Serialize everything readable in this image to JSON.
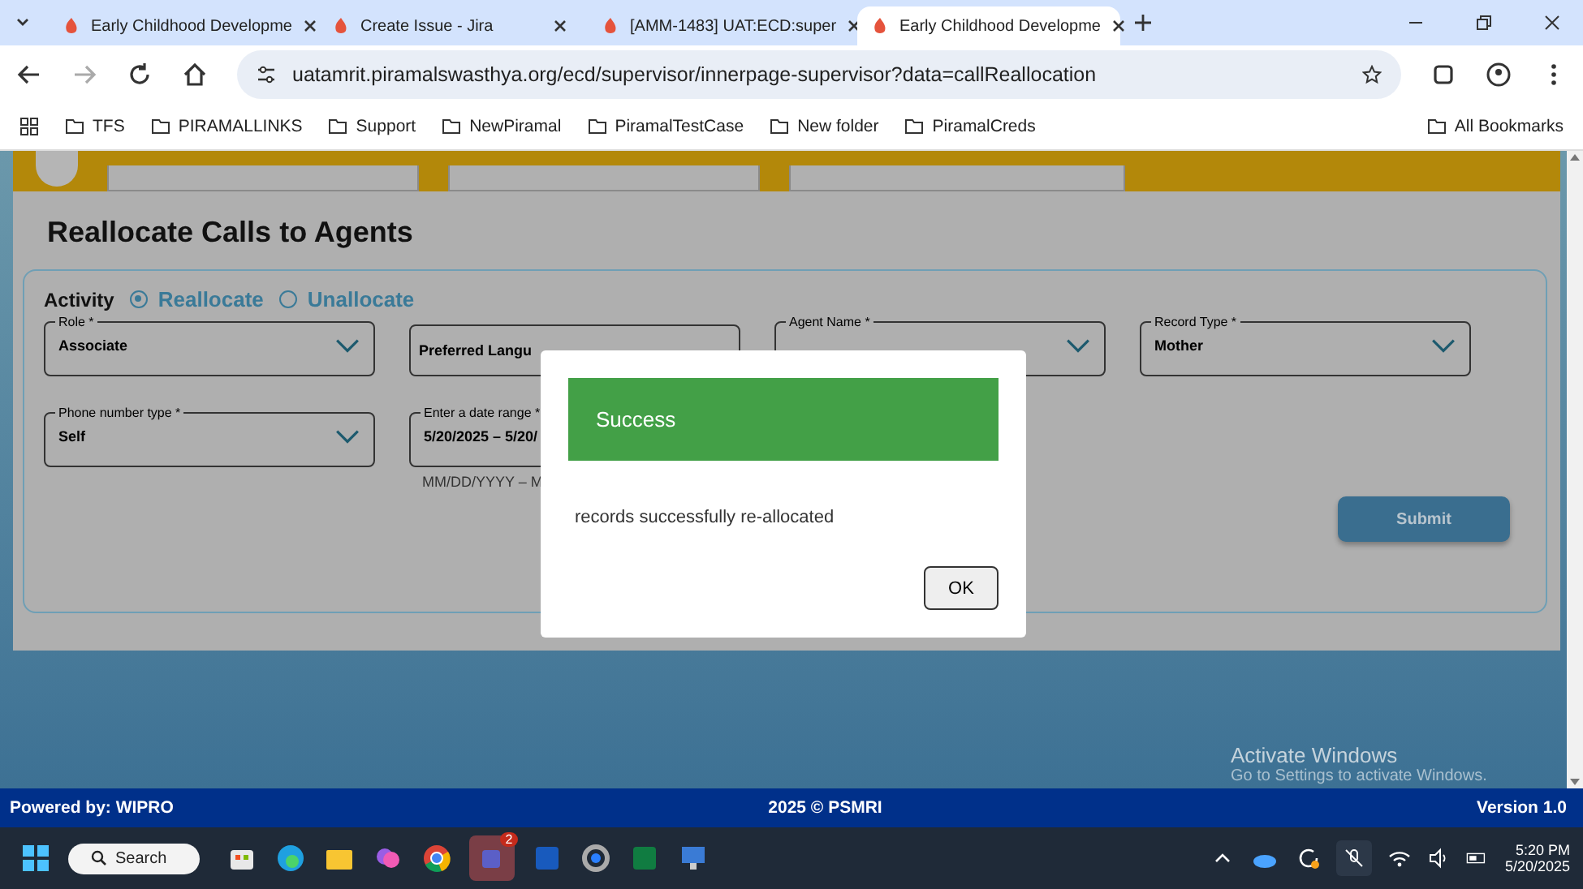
{
  "browser": {
    "tabs": [
      {
        "title": "Early Childhood Developme",
        "selected": false
      },
      {
        "title": "Create Issue - Jira",
        "selected": false
      },
      {
        "title": "[AMM-1483] UAT:ECD:super",
        "selected": false
      },
      {
        "title": "Early Childhood Developme",
        "selected": true
      }
    ],
    "address": "uatamrit.piramalswasthya.org/ecd/supervisor/innerpage-supervisor?data=callReallocation",
    "bookmarks": [
      "TFS",
      "PIRAMALLINKS",
      "Support",
      "NewPiramal",
      "PiramalTestCase",
      "New folder",
      "PiramalCreds"
    ],
    "all_bookmarks": "All Bookmarks"
  },
  "page": {
    "title": "Reallocate Calls to Agents",
    "activity_label": "Activity",
    "radios": [
      {
        "label": "Reallocate",
        "selected": true
      },
      {
        "label": "Unallocate",
        "selected": false
      }
    ],
    "fields": [
      {
        "kind": "select",
        "label": "Role *",
        "value": "Associate"
      },
      {
        "kind": "plain",
        "placeholder": "Preferred Langu"
      },
      {
        "kind": "select",
        "label": "Agent Name *"
      },
      {
        "kind": "select",
        "label": "Record Type *",
        "value": "Mother"
      },
      {
        "kind": "select",
        "label": "Phone number type *",
        "value": "Self"
      },
      {
        "kind": "date",
        "label": "Enter a date range *",
        "value": "5/20/2025 – 5/20/",
        "hint": "MM/DD/YYYY – M"
      }
    ],
    "submit": "Submit"
  },
  "dialog": {
    "title": "Success",
    "message": "records successfully re-allocated",
    "button": "OK"
  },
  "watermark": {
    "title": "Activate Windows",
    "subtitle": "Go to Settings to activate Windows."
  },
  "footer": {
    "left": "Powered by: WIPRO",
    "center": "2025 © PSMRI",
    "right": "Version 1.0"
  },
  "taskbar": {
    "search": "Search",
    "badge": "2",
    "time": "5:20 PM",
    "date": "5/20/2025"
  }
}
